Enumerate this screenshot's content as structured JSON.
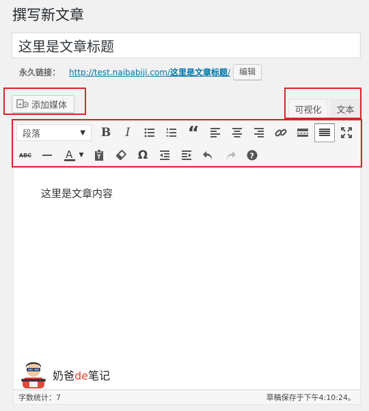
{
  "page": {
    "title": "撰写新文章"
  },
  "post": {
    "title_value": "这里是文章标题",
    "content": "这里是文章内容"
  },
  "permalink": {
    "label": "永久链接：",
    "base_url": "http://test.naibabiji.com/",
    "slug": "这里是文章标题",
    "trailing": "/",
    "edit_label": "编辑"
  },
  "media": {
    "add_label": "添加媒体",
    "icon": "media-icon"
  },
  "tabs": {
    "visual": "可视化",
    "text": "文本"
  },
  "toolbar": {
    "format_value": "段落",
    "row1_icons": [
      "bold-icon",
      "italic-icon",
      "bullet-list-icon",
      "numbered-list-icon",
      "blockquote-icon",
      "align-left-icon",
      "align-center-icon",
      "align-right-icon",
      "link-icon",
      "read-more-icon",
      "toolbar-toggle-icon",
      "fullscreen-icon"
    ],
    "row2_icons": [
      "strikethrough-icon",
      "horizontal-line-icon",
      "text-color-icon",
      "paste-text-icon",
      "clear-formatting-icon",
      "special-character-icon",
      "outdent-icon",
      "indent-icon",
      "undo-icon",
      "redo-icon",
      "help-icon"
    ]
  },
  "status": {
    "word_count": "字数统计：7",
    "draft_saved": "草稿保存于下午4:10:24。"
  },
  "watermark": {
    "prefix": "奶爸",
    "de": "de",
    "suffix": "笔记"
  },
  "colors": {
    "highlight": "#d9232a",
    "link": "#0073aa",
    "watermark_accent": "#e8452e"
  }
}
